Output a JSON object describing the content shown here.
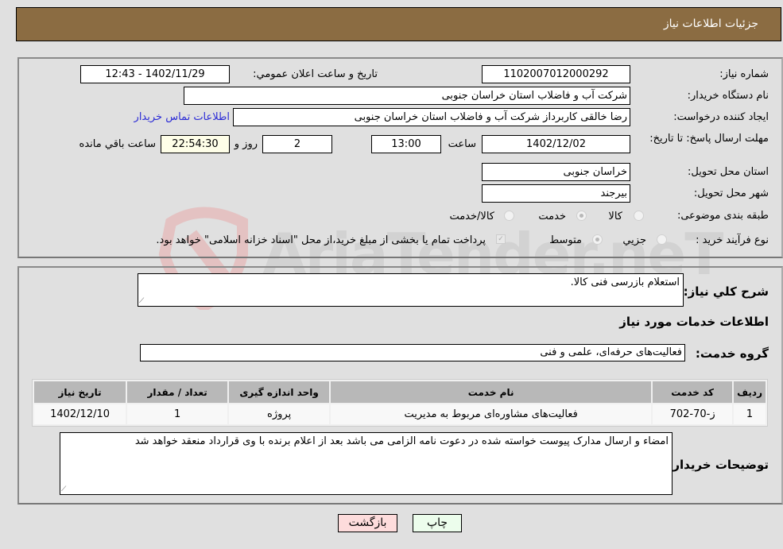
{
  "header": {
    "title": "جزئیات اطلاعات نیاز"
  },
  "details": {
    "need_number": {
      "label": "شماره نیاز:",
      "value": "1102007012000292"
    },
    "announce_datetime": {
      "label": "تاریخ و ساعت اعلان عمومي:",
      "value": "1402/11/29 - 12:43"
    },
    "buyer_org": {
      "label": "نام دستگاه خریدار:",
      "value": "شرکت آب و فاضلاب استان خراسان جنوبی"
    },
    "creator": {
      "label": "ایجاد کننده درخواست:",
      "value": "رضا خالقی کاربرداز شرکت آب و فاضلاب استان خراسان جنوبی"
    },
    "contact_link": "اطلاعات تماس خریدار",
    "deadline": {
      "label": "مهلت ارسال پاسخ: تا تاریخ:",
      "date": "1402/12/02",
      "time_label": "ساعت",
      "time": "13:00",
      "days": "2",
      "days_label": "روز و",
      "remaining": "22:54:30",
      "remaining_label": "ساعت باقي مانده"
    },
    "province": {
      "label": "استان محل تحویل:",
      "value": "خراسان جنوبی"
    },
    "city": {
      "label": "شهر محل تحویل:",
      "value": "بیرجند"
    },
    "category": {
      "label": "طبقه بندی موضوعی:",
      "options": [
        "کالا",
        "خدمت",
        "کالا/خدمت"
      ],
      "selected": "خدمت"
    },
    "purchase_type": {
      "label": "نوع فرآیند خرید :",
      "options": [
        "جزيي",
        "متوسط"
      ],
      "selected": "متوسط",
      "treasury_note": "پرداخت تمام یا بخشی از مبلغ خرید،از محل \"اسناد خزانه اسلامی\" خواهد بود."
    }
  },
  "summary": {
    "label": "شرح كلي نياز:",
    "value": "استعلام بازرسی فنی کالا."
  },
  "services_section": {
    "title": "اطلاعات خدمات مورد نیاز",
    "group_label": "گروه خدمت:",
    "group_value": "فعالیت‌های حرفه‌ای، علمی و فنی",
    "table": {
      "headers": [
        "ردیف",
        "کد خدمت",
        "نام خدمت",
        "واحد اندازه گیری",
        "تعداد / مقدار",
        "تاریخ نیاز"
      ],
      "rows": [
        [
          "1",
          "ز-70-702",
          "فعالیت‌های مشاوره‌ای مربوط به مدیریت",
          "پروژه",
          "1",
          "1402/12/10"
        ]
      ]
    }
  },
  "buyer_notes": {
    "label": "توضیحات خریدار:",
    "value": "امضاء و ارسال مدارک پیوست خواسته شده در دعوت نامه الزامی می باشد بعد از اعلام برنده با وی قرارداد منعقد خواهد شد"
  },
  "buttons": {
    "print": "چاپ",
    "back": "بازگشت"
  },
  "watermark": {
    "text": "AriaTender.neT"
  },
  "colors": {
    "header_bg": "#8b6c42",
    "print_bg": "#ecfdec",
    "back_bg": "#fddcdc",
    "link": "#2b2bd6"
  }
}
